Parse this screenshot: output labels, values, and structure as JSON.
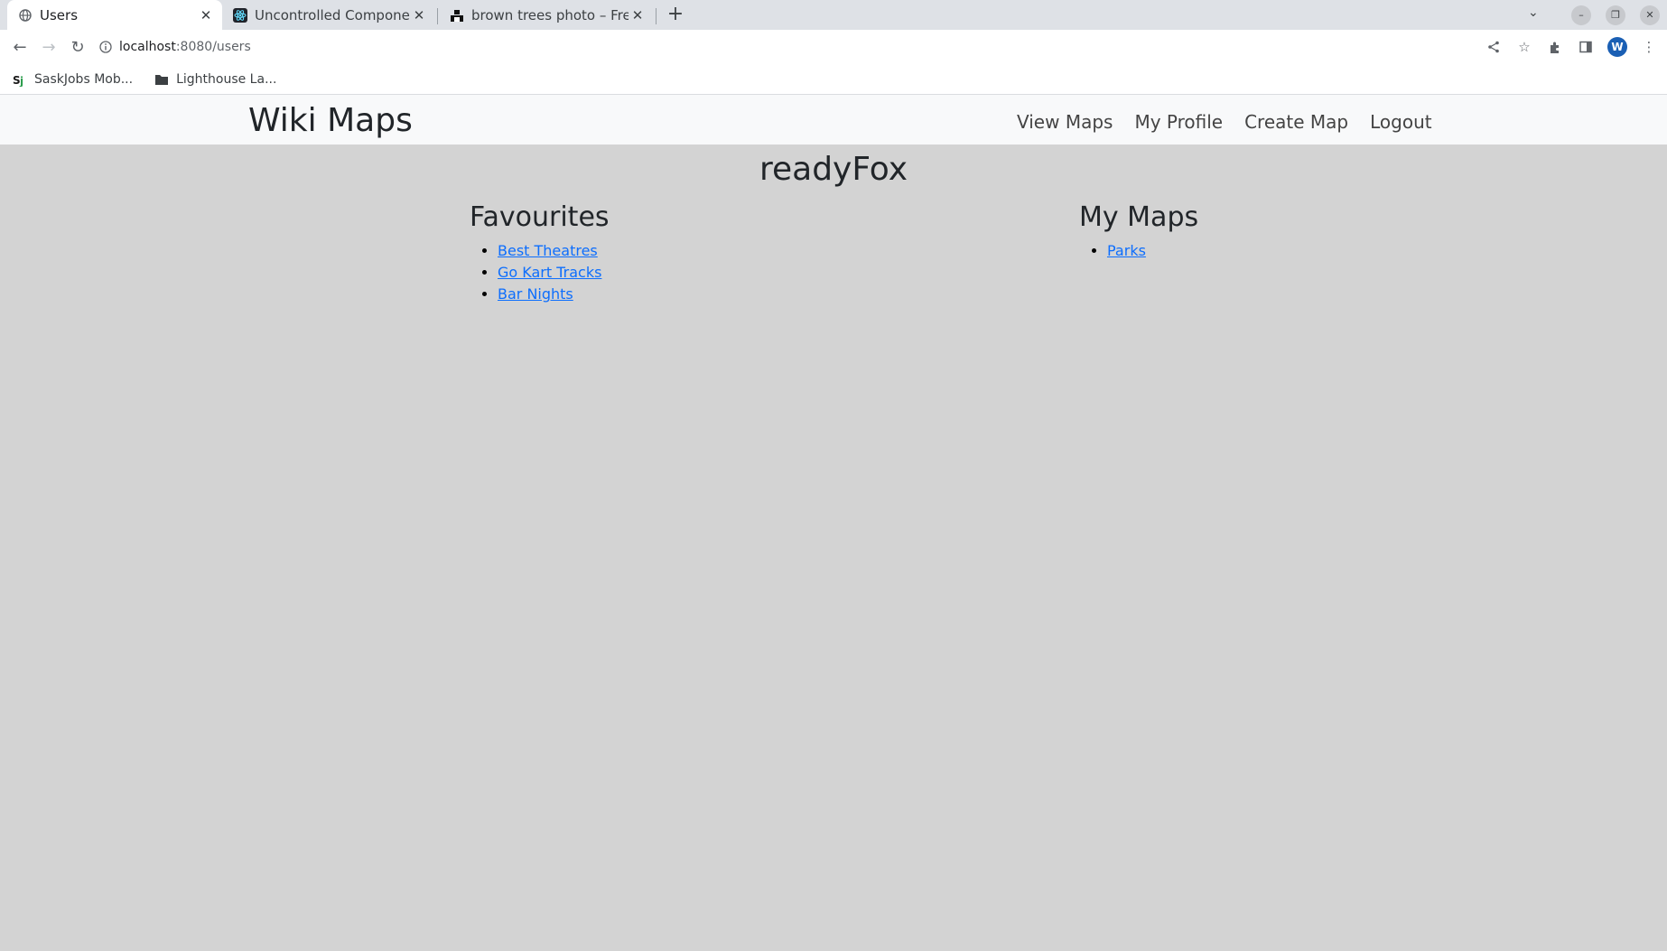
{
  "browser": {
    "tabs": [
      {
        "title": "Users",
        "icon": "globe-icon",
        "active": true
      },
      {
        "title": "Uncontrolled Component",
        "icon": "react-icon",
        "active": false
      },
      {
        "title": "brown trees photo – Free",
        "icon": "unsplash-icon",
        "active": false
      }
    ],
    "url_host": "localhost",
    "url_path": ":8080/users",
    "profile_initial": "W",
    "bookmarks": [
      {
        "label": "SaskJobs Mob...",
        "icon": "saskjobs-icon"
      },
      {
        "label": "Lighthouse La...",
        "icon": "folder-icon"
      }
    ]
  },
  "site": {
    "brand": "Wiki Maps",
    "nav": [
      "View Maps",
      "My Profile",
      "Create Map",
      "Logout"
    ]
  },
  "profile": {
    "username": "readyFox",
    "favourites_title": "Favourites",
    "favourites": [
      "Best Theatres",
      "Go Kart Tracks",
      "Bar Nights"
    ],
    "my_maps_title": "My Maps",
    "my_maps": [
      "Parks"
    ]
  },
  "colors": {
    "page_bg": "#d3d3d3",
    "navbar_bg": "#f8f9fa",
    "link": "#0d6efd",
    "avatar": "#1a5fb4"
  }
}
